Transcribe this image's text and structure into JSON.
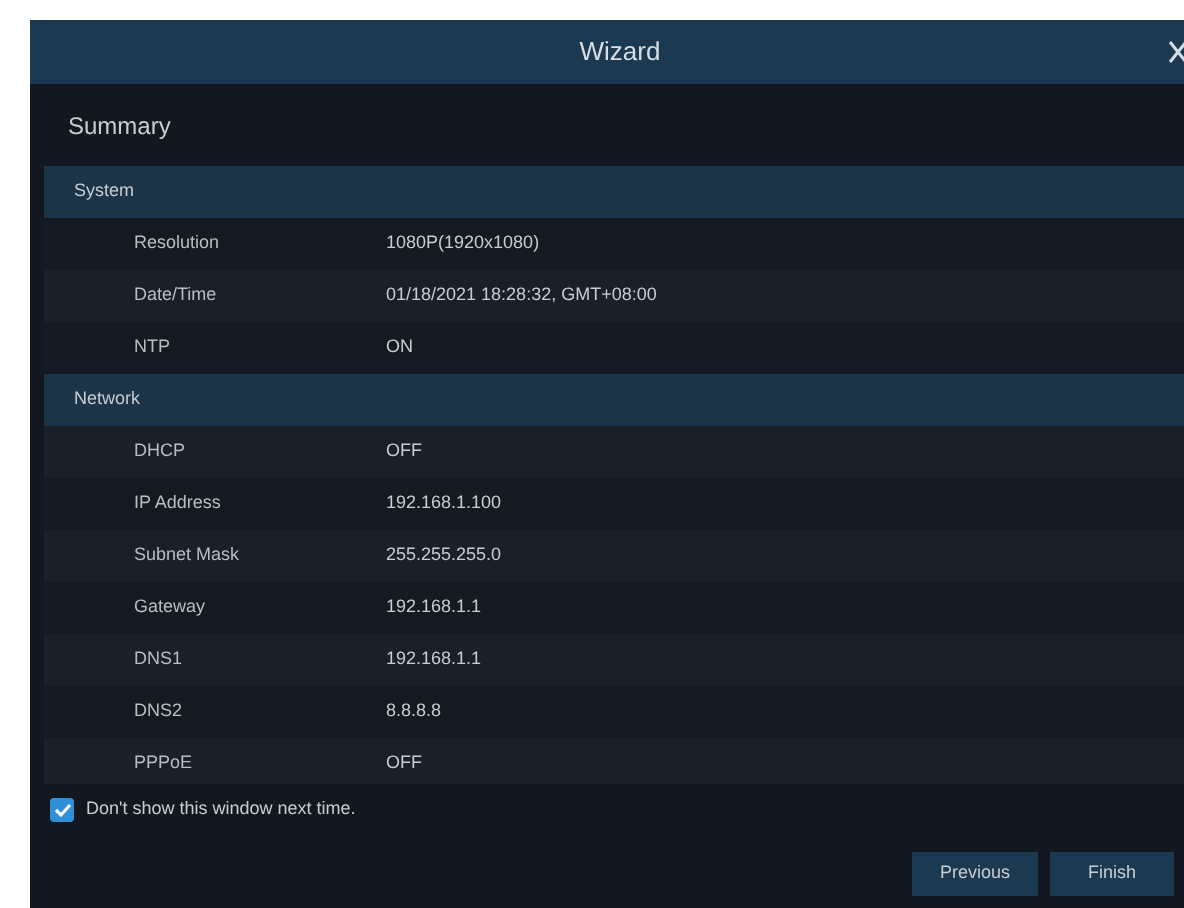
{
  "window": {
    "title": "Wizard"
  },
  "heading": "Summary",
  "sections": [
    {
      "title": "System",
      "rows": [
        {
          "label": "Resolution",
          "value": "1080P(1920x1080)"
        },
        {
          "label": "Date/Time",
          "value": "01/18/2021 18:28:32, GMT+08:00"
        },
        {
          "label": "NTP",
          "value": "ON"
        }
      ]
    },
    {
      "title": "Network",
      "rows": [
        {
          "label": "DHCP",
          "value": "OFF"
        },
        {
          "label": "IP Address",
          "value": "192.168.1.100"
        },
        {
          "label": "Subnet Mask",
          "value": "255.255.255.0"
        },
        {
          "label": "Gateway",
          "value": "192.168.1.1"
        },
        {
          "label": "DNS1",
          "value": "192.168.1.1"
        },
        {
          "label": "DNS2",
          "value": "8.8.8.8"
        },
        {
          "label": "PPPoE",
          "value": "OFF"
        }
      ]
    }
  ],
  "dont_show": {
    "label": "Don't show this window next time.",
    "checked": true
  },
  "buttons": [
    "Previous",
    "Finish"
  ]
}
